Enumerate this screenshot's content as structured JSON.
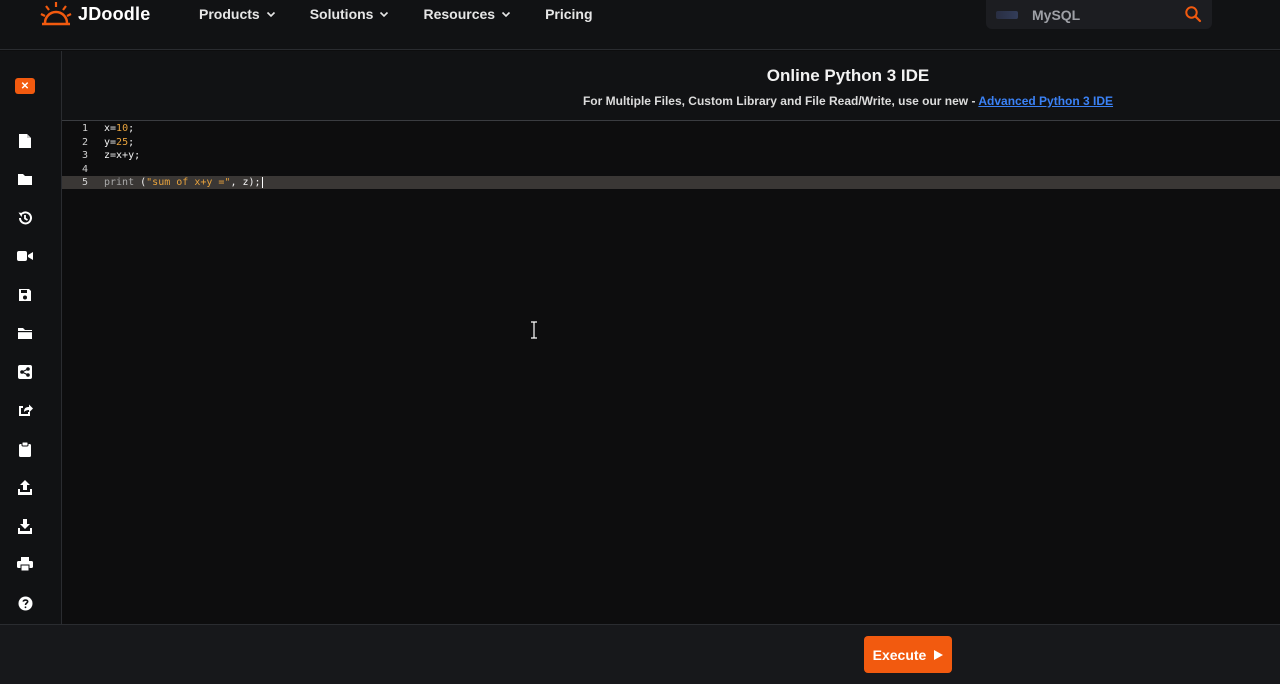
{
  "brand": {
    "name": "JDoodle",
    "accent": "#f25a0f"
  },
  "nav": {
    "items": [
      {
        "label": "Products",
        "has_dropdown": true
      },
      {
        "label": "Solutions",
        "has_dropdown": true
      },
      {
        "label": "Resources",
        "has_dropdown": true
      },
      {
        "label": "Pricing",
        "has_dropdown": false
      }
    ]
  },
  "search": {
    "value": "MySQL",
    "icon": "search-icon"
  },
  "sidebar": {
    "close_label": "✕",
    "icons": [
      "new-file-icon",
      "folder-icon",
      "history-icon",
      "video-icon",
      "save-icon",
      "open-folder-icon",
      "share-icon",
      "external-share-icon",
      "clipboard-icon",
      "upload-icon",
      "download-icon",
      "print-icon",
      "help-icon"
    ]
  },
  "header": {
    "title": "Online Python 3 IDE",
    "subtitle": "For Multiple Files, Custom Library and File Read/Write, use our new - ",
    "link_text": "Advanced Python 3 IDE"
  },
  "editor": {
    "active_line": 5,
    "lines": [
      {
        "n": "1",
        "code": "x=10;"
      },
      {
        "n": "2",
        "code": "y=25;"
      },
      {
        "n": "3",
        "code": "z=x+y;"
      },
      {
        "n": "4",
        "code": ""
      },
      {
        "n": "5",
        "code": "print (\"sum of x+y =\", z);"
      }
    ]
  },
  "footer": {
    "execute_label": "Execute"
  }
}
